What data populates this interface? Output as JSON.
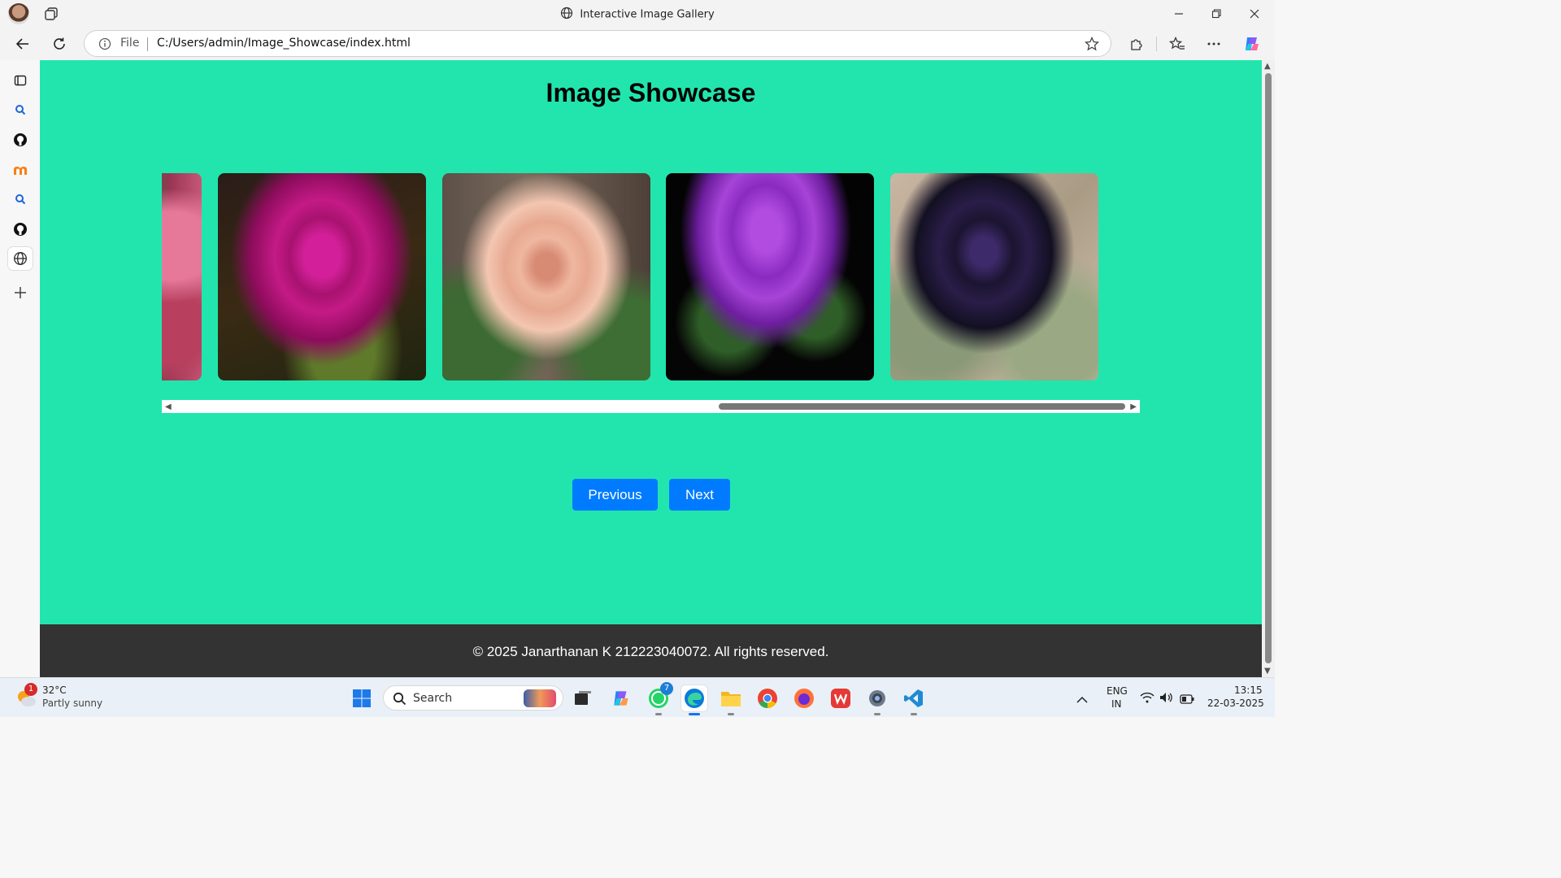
{
  "browser": {
    "window_title": "Interactive Image Gallery",
    "address_scheme": "File",
    "url": "C:/Users/admin/Image_Showcase/index.html"
  },
  "page": {
    "heading": "Image Showcase",
    "gallery": {
      "images": [
        {
          "alt": "pink rose (partially visible)",
          "color": "#c8506e"
        },
        {
          "alt": "magenta rose",
          "color": "#b5157a"
        },
        {
          "alt": "peach rose with dew",
          "color": "#eab39a"
        },
        {
          "alt": "purple rose on black",
          "color": "#8c2bc4"
        },
        {
          "alt": "dark violet rose",
          "color": "#2a1a3d"
        }
      ],
      "scroll_position_fraction": 0.6
    },
    "buttons": {
      "previous": "Previous",
      "next": "Next"
    },
    "footer": "© 2025 Janarthanan K 212223040072. All rights reserved.",
    "colors": {
      "background": "#22e5ae",
      "button": "#007bff",
      "footer": "#333333"
    }
  },
  "taskbar": {
    "weather": {
      "temp": "32°C",
      "desc": "Partly sunny",
      "badge": "1"
    },
    "search_placeholder": "Search",
    "whatsapp_badge": "7",
    "lang": {
      "line1": "ENG",
      "line2": "IN"
    },
    "clock": {
      "time": "13:15",
      "date": "22-03-2025"
    }
  }
}
